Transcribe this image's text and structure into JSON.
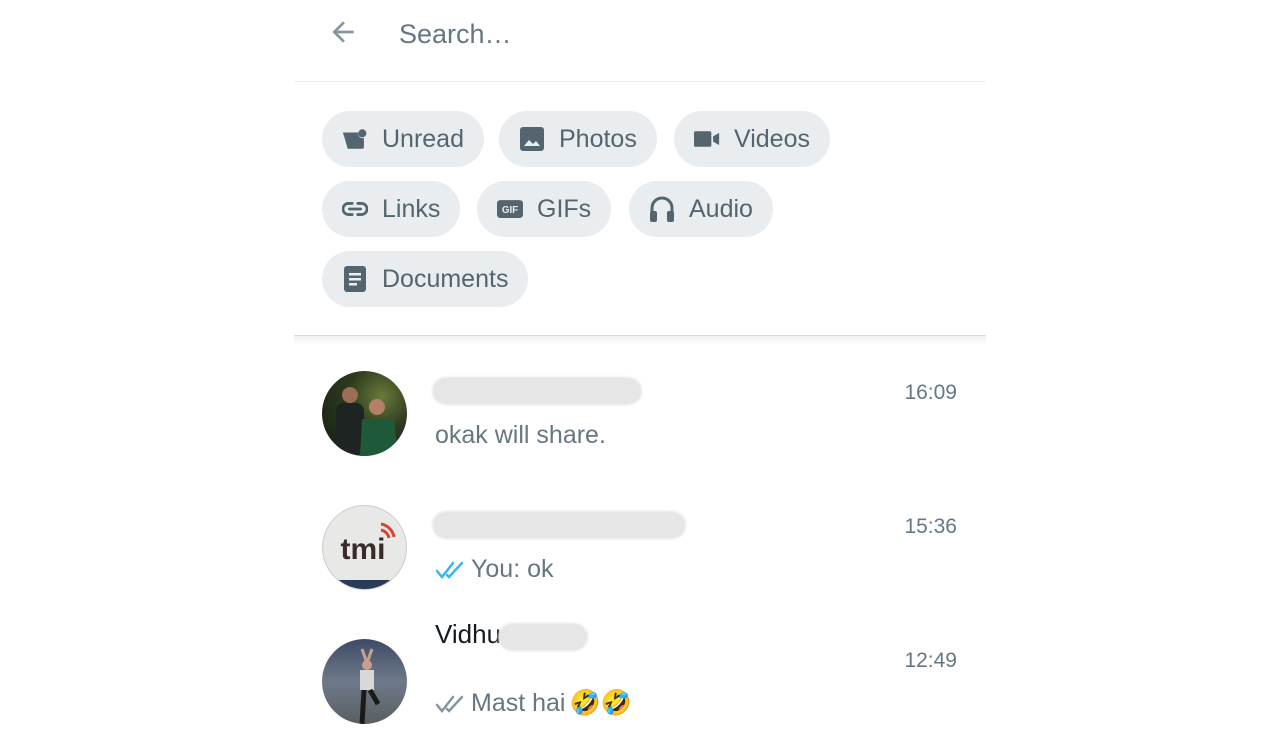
{
  "search": {
    "placeholder": "Search…",
    "back_icon": "arrow-left-icon"
  },
  "filters": [
    {
      "label": "Unread",
      "icon": "unread-chat-icon"
    },
    {
      "label": "Photos",
      "icon": "photo-icon"
    },
    {
      "label": "Videos",
      "icon": "videocam-icon"
    },
    {
      "label": "Links",
      "icon": "link-icon"
    },
    {
      "label": "GIFs",
      "icon": "gif-icon"
    },
    {
      "label": "Audio",
      "icon": "headphones-icon"
    },
    {
      "label": "Documents",
      "icon": "document-icon"
    }
  ],
  "chats": [
    {
      "name": "",
      "name_redacted": true,
      "time": "16:09",
      "preview": "okak will  share.",
      "status": "none",
      "emoji": ""
    },
    {
      "name": "",
      "name_redacted": true,
      "time": "15:36",
      "preview": "You: ok",
      "status": "read",
      "emoji": ""
    },
    {
      "name": "Vidhu",
      "name_redacted": true,
      "time": "12:49",
      "preview": "Mast hai",
      "status": "delivered",
      "emoji": "🤣🤣"
    }
  ],
  "colors": {
    "chip_bg": "#e9edef",
    "icon": "#54656f",
    "text_secondary": "#667781",
    "read_tick": "#34b7f1",
    "delivered_tick": "#8696a0"
  }
}
